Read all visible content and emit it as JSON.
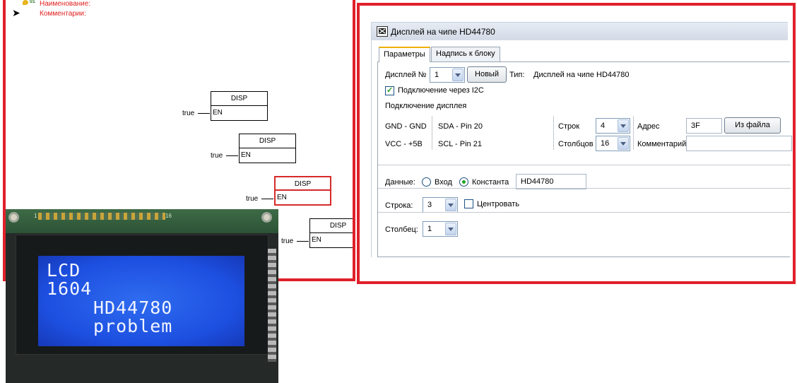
{
  "editor": {
    "name_label": "Наименование:",
    "comment_label": "Комментарии:",
    "head_icon_num": "01",
    "blocks": [
      {
        "title": "DISP",
        "pin": "EN",
        "input": "true",
        "selected": false
      },
      {
        "title": "DISP",
        "pin": "EN",
        "input": "true",
        "selected": false
      },
      {
        "title": "DISP",
        "pin": "EN",
        "input": "true",
        "selected": true
      },
      {
        "title": "DISP",
        "pin": "EN",
        "input": "true",
        "selected": false
      }
    ]
  },
  "photo": {
    "pcb_label_left": "1",
    "pcb_label_right": "16",
    "lcd_lines": [
      "LCD",
      "1604",
      "HD44780",
      "problem"
    ]
  },
  "dialog": {
    "title": "Дисплей на чипе HD44780",
    "tabs": [
      "Параметры",
      "Надпись к блоку"
    ],
    "display_no_label": "Дисплей №",
    "display_no_value": "1",
    "new_button": "Новый",
    "type_label": "Тип:",
    "type_value": "Дисплей на чипе HD44780",
    "i2c_label": "Подключение через I2C",
    "i2c_checked": true,
    "connection_heading": "Подключение дисплея",
    "gnd_label": "GND - GND",
    "vcc_label": "VCC - +5B",
    "sda_label": "SDA -  Pin 20",
    "scl_label": "SCL -  Pin 21",
    "rows_label": "Строк",
    "rows_value": "4",
    "cols_label": "Столбцов",
    "cols_value": "16",
    "address_label": "Адрес",
    "address_value": "3F",
    "from_file_button": "Из файла",
    "comment_label": "Комментарий",
    "comment_value": "",
    "data_label": "Данные:",
    "radio_input_label": "Вход",
    "radio_const_label": "Константа",
    "selected_data_mode": "Константа",
    "const_value": "HD44780",
    "line_label": "Строка:",
    "line_value": "3",
    "center_label": "Центровать",
    "center_checked": false,
    "column_label": "Столбец:",
    "column_value": "1"
  },
  "colors": {
    "frame_red": "#e0202a",
    "meta_red": "#e02020",
    "selected_block": "#d62a2a",
    "lcd_blue": "#1d4fe0",
    "check_green": "#21a121"
  }
}
